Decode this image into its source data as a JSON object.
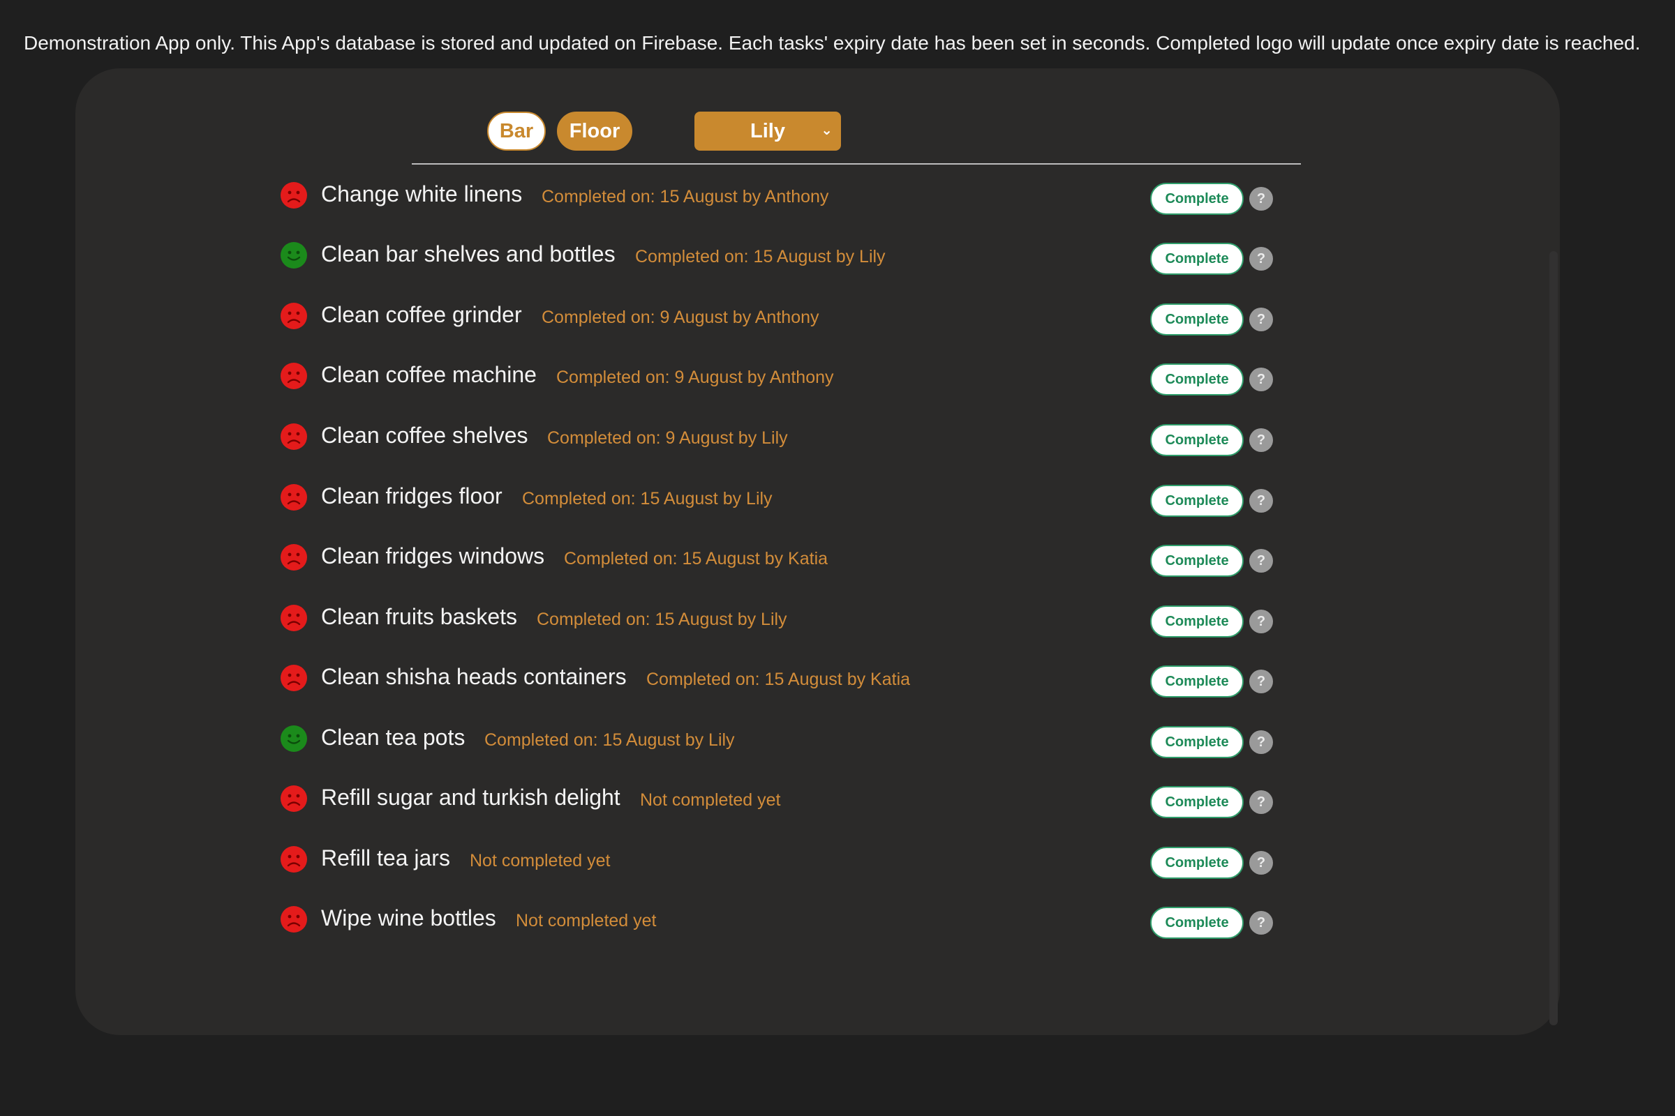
{
  "notice": "Demonstration App only. This App's database is stored and updated on Firebase. Each tasks' expiry date has been set in seconds. Completed logo will update once expiry date is reached.",
  "filters": {
    "bar_label": "Bar",
    "floor_label": "Floor",
    "selected_staff": "Lily",
    "active_filter": "Floor"
  },
  "complete_label": "Complete",
  "help_label": "?",
  "colors": {
    "accent": "#c9892e",
    "status_text": "#d38d3a",
    "done": "#1b8a1b",
    "not_done": "#e41b1b",
    "button_green": "#1d8a58"
  },
  "tasks": [
    {
      "name": "Change white linens",
      "status": "Completed on: 15 August by Anthony",
      "state": "sad"
    },
    {
      "name": "Clean bar shelves and bottles",
      "status": "Completed on: 15 August by Lily",
      "state": "happy"
    },
    {
      "name": "Clean coffee grinder",
      "status": "Completed on: 9 August by Anthony",
      "state": "sad"
    },
    {
      "name": "Clean coffee machine",
      "status": "Completed on: 9 August by Anthony",
      "state": "sad"
    },
    {
      "name": "Clean coffee shelves",
      "status": "Completed on: 9 August by Lily",
      "state": "sad"
    },
    {
      "name": "Clean fridges floor",
      "status": "Completed on: 15 August by Lily",
      "state": "sad"
    },
    {
      "name": "Clean fridges windows",
      "status": "Completed on: 15 August by Katia",
      "state": "sad"
    },
    {
      "name": "Clean fruits baskets",
      "status": "Completed on: 15 August by Lily",
      "state": "sad"
    },
    {
      "name": "Clean shisha heads containers",
      "status": "Completed on: 15 August by Katia",
      "state": "sad"
    },
    {
      "name": "Clean tea pots",
      "status": "Completed on: 15 August by Lily",
      "state": "happy"
    },
    {
      "name": "Refill sugar and turkish delight",
      "status": "Not completed yet",
      "state": "sad"
    },
    {
      "name": "Refill tea jars",
      "status": "Not completed yet",
      "state": "sad"
    },
    {
      "name": "Wipe wine bottles",
      "status": "Not completed yet",
      "state": "sad"
    }
  ]
}
